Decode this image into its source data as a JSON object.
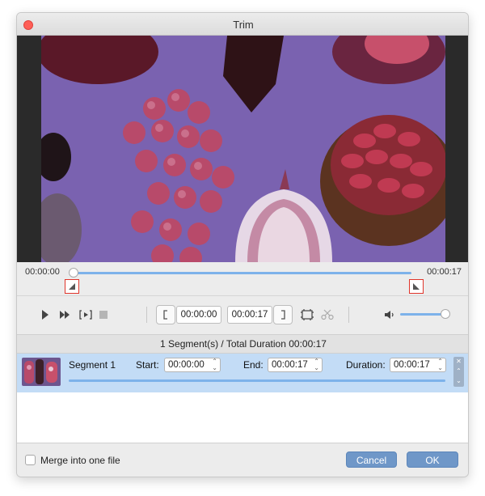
{
  "window": {
    "title": "Trim"
  },
  "timeline": {
    "start_time": "00:00:00",
    "end_time": "00:00:17"
  },
  "controls": {
    "clip_start": "00:00:00",
    "clip_end": "00:00:17",
    "icons": [
      "play-icon",
      "fast-forward-icon",
      "play-selection-icon",
      "stop-icon",
      "set-start-bracket-icon",
      "set-end-bracket-icon",
      "add-segment-icon",
      "split-icon",
      "volume-icon"
    ],
    "volume_level": 0.9
  },
  "segments_header": "1 Segment(s) / Total Duration 00:00:17",
  "segments": [
    {
      "name": "Segment 1",
      "start_label": "Start:",
      "start": "00:00:00",
      "end_label": "End:",
      "end": "00:00:17",
      "duration_label": "Duration:",
      "duration": "00:00:17"
    }
  ],
  "footer": {
    "merge_label": "Merge into one file",
    "merge_checked": false,
    "cancel_label": "Cancel",
    "ok_label": "OK"
  },
  "colors": {
    "accent": "#7db2ea",
    "marker": "#e0352b",
    "button": "#6f97c8",
    "video_bg": "#7a62b0"
  }
}
